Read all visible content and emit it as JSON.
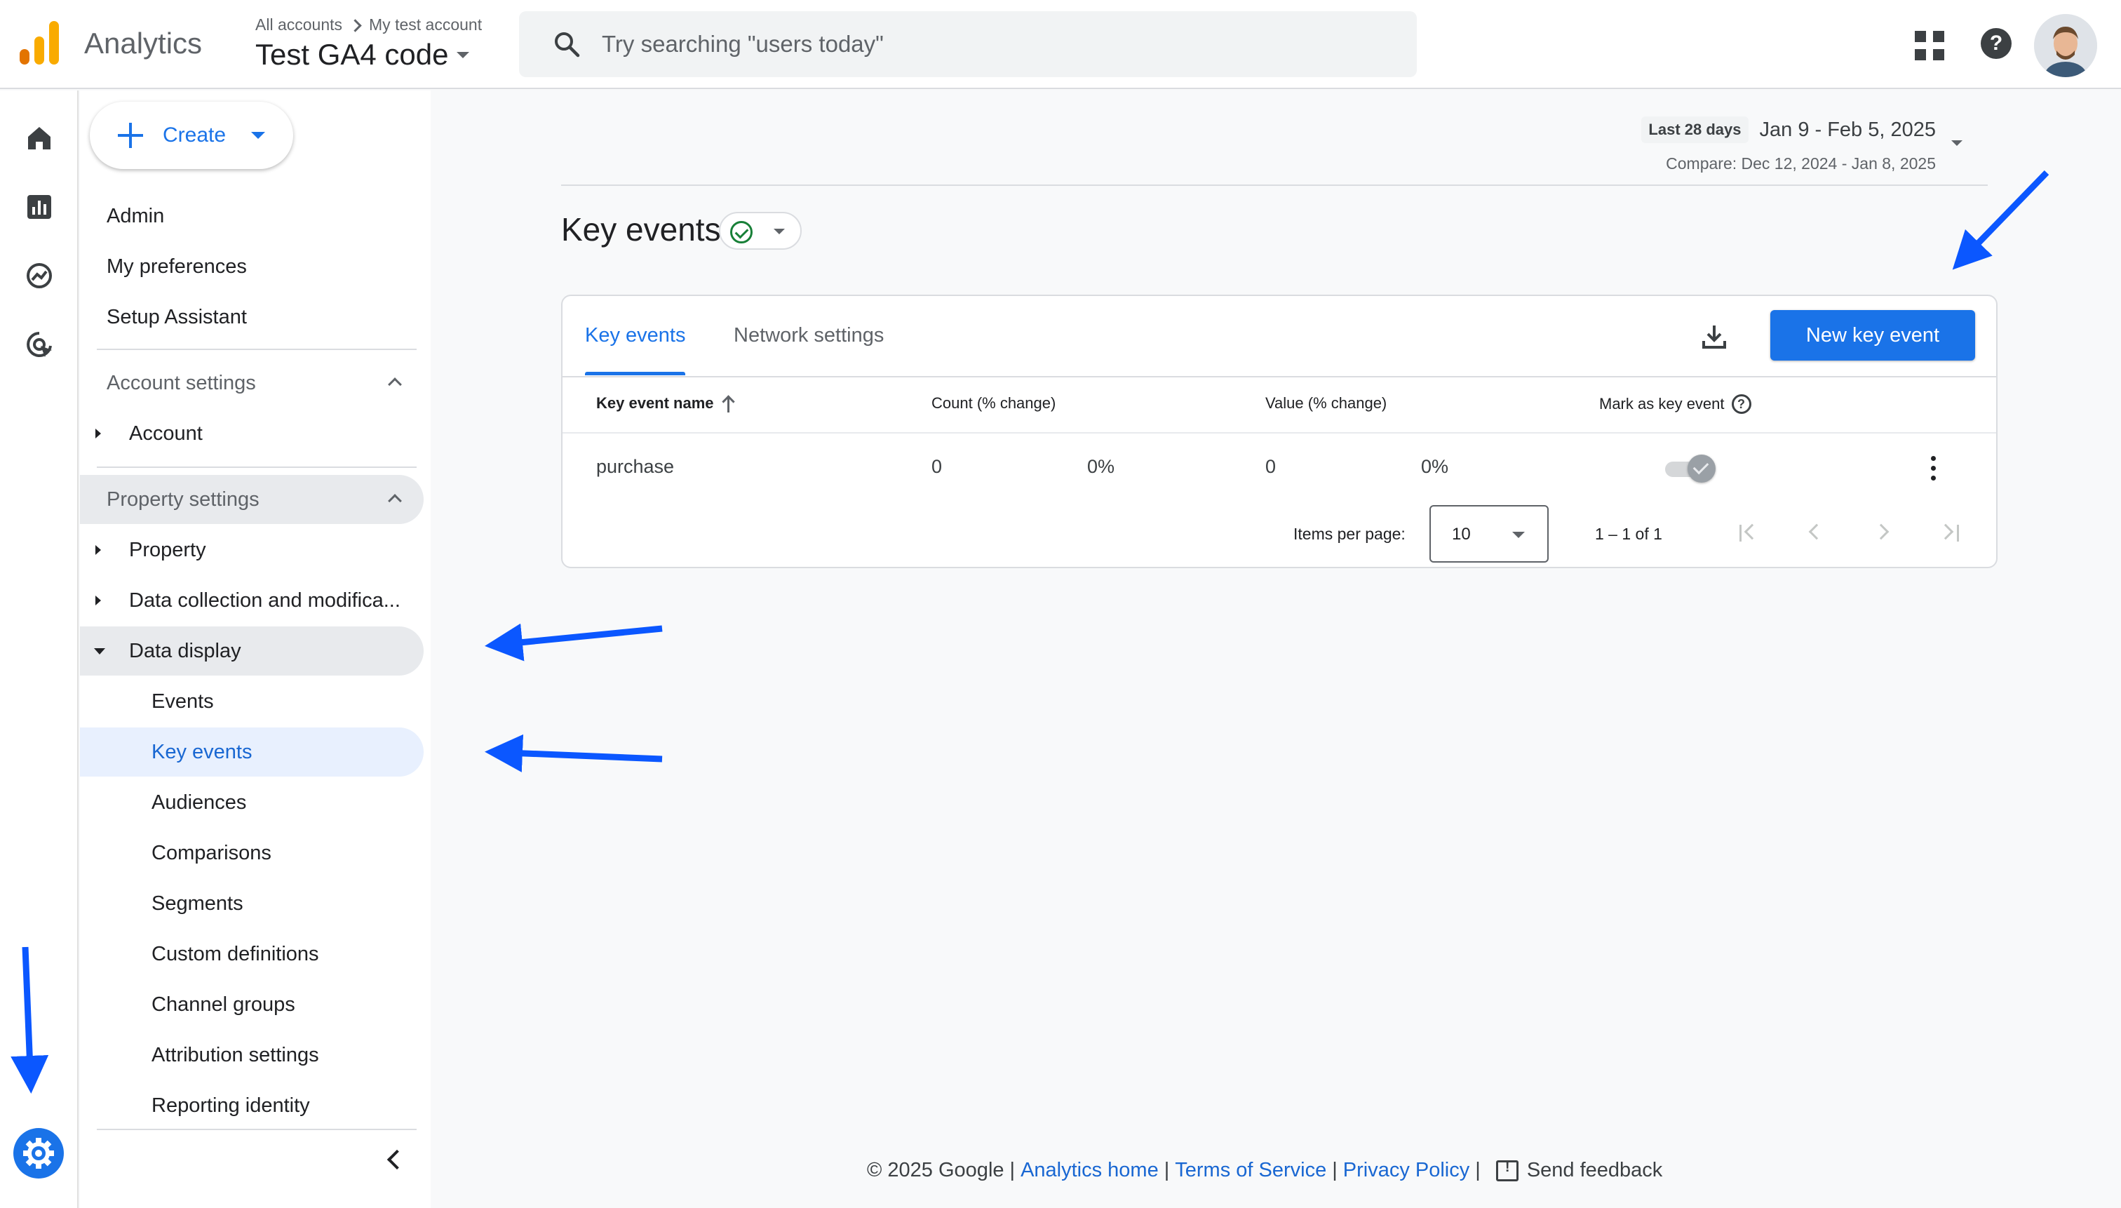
{
  "header": {
    "app_name": "Analytics",
    "breadcrumb": [
      "All accounts",
      "My test account"
    ],
    "property_name": "Test GA4 code",
    "search_placeholder": "Try searching \"users today\""
  },
  "sidebar": {
    "create_label": "Create",
    "top_items": [
      "Admin",
      "My preferences",
      "Setup Assistant"
    ],
    "account_section": {
      "label": "Account settings",
      "items": [
        "Account"
      ]
    },
    "property_section": {
      "label": "Property settings",
      "items": [
        "Property",
        "Data collection and modifica...",
        "Data display"
      ],
      "data_display_items": [
        "Events",
        "Key events",
        "Audiences",
        "Comparisons",
        "Segments",
        "Custom definitions",
        "Channel groups",
        "Attribution settings",
        "Reporting identity"
      ]
    }
  },
  "date_range": {
    "preset": "Last 28 days",
    "range": "Jan 9 - Feb 5, 2025",
    "compare": "Compare: Dec 12, 2024 - Jan 8, 2025"
  },
  "page": {
    "title": "Key events"
  },
  "card": {
    "tabs": [
      "Key events",
      "Network settings"
    ],
    "new_button": "New key event",
    "columns": [
      "Key event name",
      "Count (% change)",
      "Value (% change)",
      "Mark as key event"
    ],
    "rows": [
      {
        "name": "purchase",
        "count": "0",
        "count_change": "0%",
        "value": "0",
        "value_change": "0%",
        "marked": true
      }
    ],
    "items_per_page_label": "Items per page:",
    "items_per_page": "10",
    "range_label": "1 – 1 of 1"
  },
  "footer": {
    "copyright": "© 2025 Google",
    "links": [
      "Analytics home",
      "Terms of Service",
      "Privacy Policy"
    ],
    "feedback": "Send feedback"
  },
  "colors": {
    "accent": "#1a73e8",
    "arrow": "#0b57ff",
    "logo_orange": "#f9ab00",
    "logo_dark": "#e37400"
  }
}
